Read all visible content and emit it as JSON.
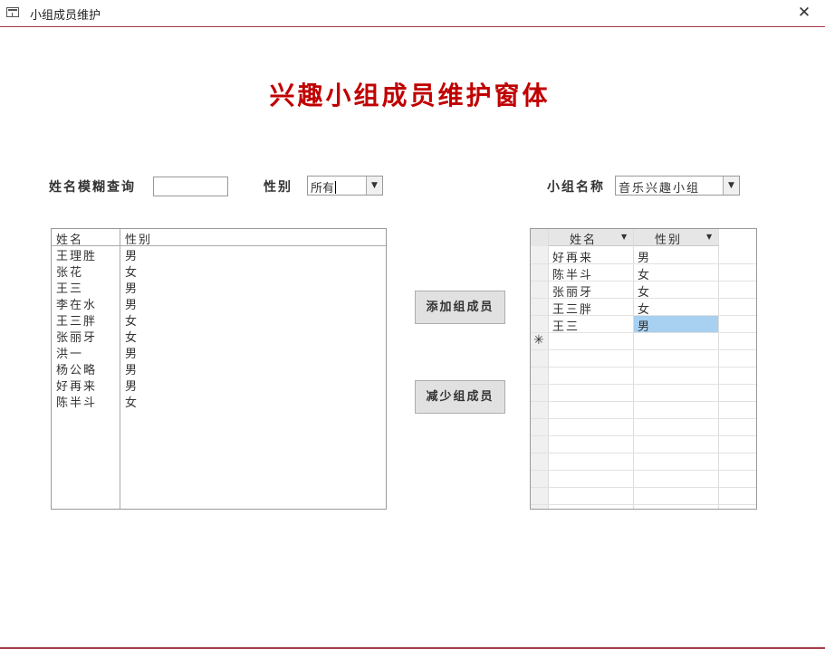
{
  "window": {
    "title": "小组成员维护",
    "close_icon": "close-icon"
  },
  "form": {
    "heading": "兴趣小组成员维护窗体"
  },
  "filters": {
    "name_search_label": "姓名模糊查询",
    "name_search_value": "",
    "gender_label": "性别",
    "gender_value": "所有",
    "group_label": "小组名称",
    "group_value": "音乐兴趣小组"
  },
  "member_list": {
    "columns": [
      "姓名",
      "性别"
    ],
    "rows": [
      {
        "name": "王理胜",
        "gender": "男"
      },
      {
        "name": "张花",
        "gender": "女"
      },
      {
        "name": "王三",
        "gender": "男"
      },
      {
        "name": "李在水",
        "gender": "男"
      },
      {
        "name": "王三胖",
        "gender": "女"
      },
      {
        "name": "张丽牙",
        "gender": "女"
      },
      {
        "name": "洪一",
        "gender": "男"
      },
      {
        "name": "杨公略",
        "gender": "男"
      },
      {
        "name": "好再来",
        "gender": "男"
      },
      {
        "name": "陈半斗",
        "gender": "女"
      }
    ]
  },
  "buttons": {
    "add": "添加组成员",
    "remove": "减少组成员"
  },
  "group_grid": {
    "columns": [
      "姓名",
      "性别"
    ],
    "rows": [
      {
        "name": "好再来",
        "gender": "男"
      },
      {
        "name": "陈半斗",
        "gender": "女"
      },
      {
        "name": "张丽牙",
        "gender": "女"
      },
      {
        "name": "王三胖",
        "gender": "女"
      },
      {
        "name": "王三",
        "gender": "男"
      }
    ],
    "new_row_marker": "✳",
    "selected_cell": {
      "row": 4,
      "column": 1
    }
  },
  "colors": {
    "accent": "#a23a4a",
    "heading": "#c00000",
    "selection": "#a8d0f0"
  }
}
